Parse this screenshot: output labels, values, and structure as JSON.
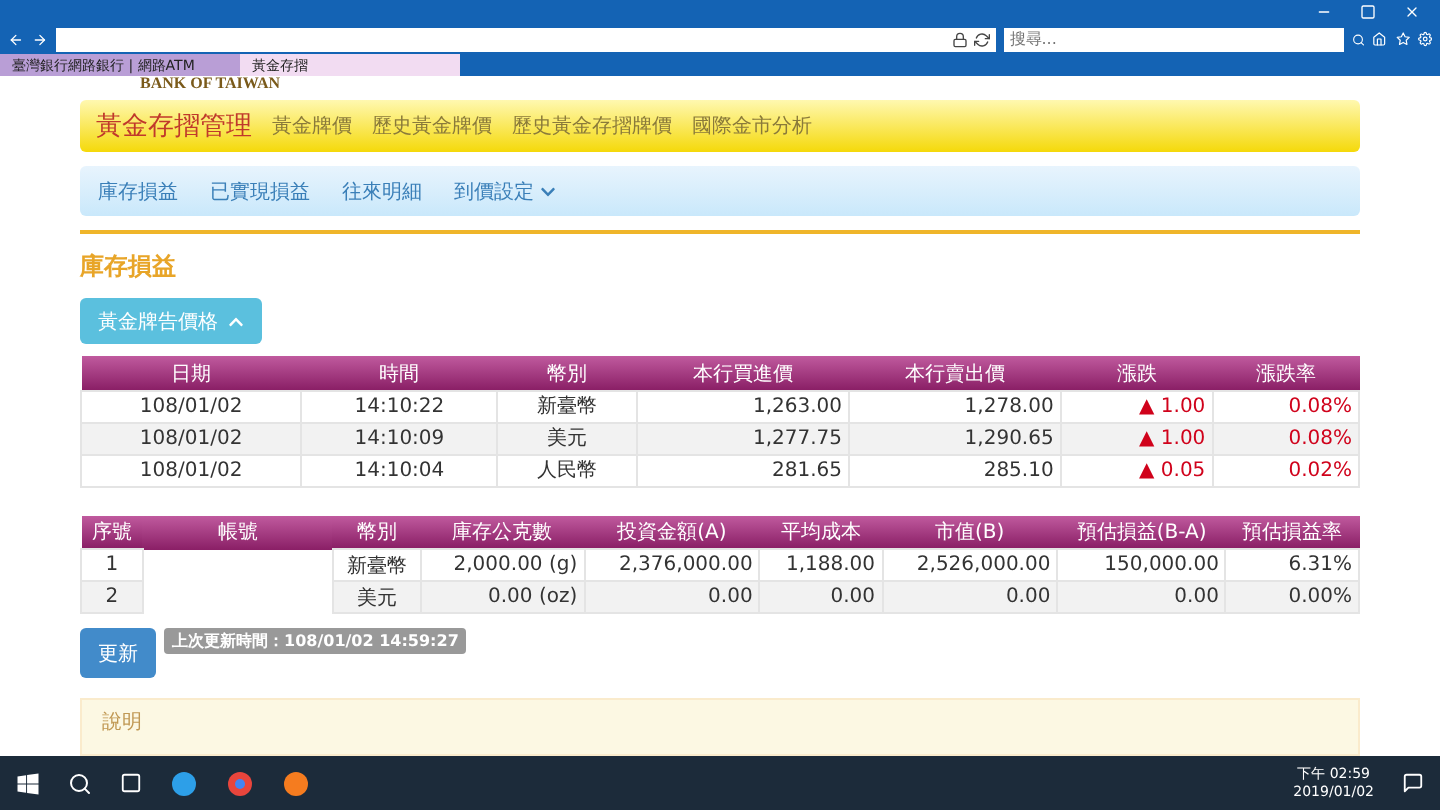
{
  "browser": {
    "search_placeholder": "搜尋...",
    "tabs": [
      {
        "label": "臺灣銀行網路銀行 | 網路ATM",
        "selected": false
      },
      {
        "label": "黃金存摺",
        "selected": true
      }
    ]
  },
  "site": {
    "logo_text": "BANK OF TAIWAN"
  },
  "main_nav": {
    "title": "黃金存摺管理",
    "items": [
      "黃金牌價",
      "歷史黃金牌價",
      "歷史黃金存摺牌價",
      "國際金市分析"
    ]
  },
  "sub_nav": [
    {
      "label": "庫存損益",
      "dropdown": false
    },
    {
      "label": "已實現損益",
      "dropdown": false
    },
    {
      "label": "往來明細",
      "dropdown": false
    },
    {
      "label": "到價設定",
      "dropdown": true
    }
  ],
  "section_title": "庫存損益",
  "price_toggle": {
    "label": "黃金牌告價格",
    "expanded": true
  },
  "price_table": {
    "columns": [
      "日期",
      "時間",
      "幣別",
      "本行買進價",
      "本行賣出價",
      "漲跌",
      "漲跌率"
    ],
    "rows": [
      {
        "cells": [
          "108/01/02",
          "14:10:22",
          "新臺幣",
          "1,263.00",
          "1,278.00",
          "▲ 1.00",
          "0.08%"
        ]
      },
      {
        "cells": [
          "108/01/02",
          "14:10:09",
          "美元",
          "1,277.75",
          "1,290.65",
          "▲ 1.00",
          "0.08%"
        ]
      },
      {
        "cells": [
          "108/01/02",
          "14:10:04",
          "人民幣",
          "281.65",
          "285.10",
          "▲ 0.05",
          "0.02%"
        ]
      }
    ]
  },
  "holdings_table": {
    "columns": [
      "序號",
      "帳號",
      "幣別",
      "庫存公克數",
      "投資金額(A)",
      "平均成本",
      "市值(B)",
      "預估損益(B-A)",
      "預估損益率"
    ],
    "rows": [
      [
        "1",
        "",
        "新臺幣",
        "2,000.00 (g)",
        "2,376,000.00",
        "1,188.00",
        "2,526,000.00",
        "150,000.00",
        "6.31%"
      ],
      [
        "2",
        "",
        "美元",
        "0.00 (oz)",
        "0.00",
        "0.00",
        "0.00",
        "0.00",
        "0.00%"
      ]
    ]
  },
  "refresh_button": "更新",
  "last_update": "上次更新時間：108/01/02 14:59:27",
  "notes_title": "說明",
  "taskbar": {
    "time": "下午 02:59",
    "date": "2019/01/02"
  }
}
